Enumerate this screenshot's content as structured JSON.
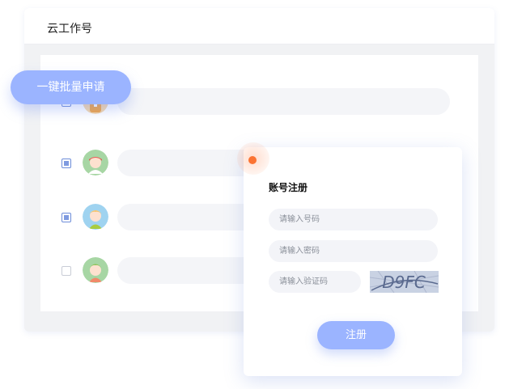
{
  "window": {
    "title": "云工作号"
  },
  "batch_button": {
    "label": "一键批量申请"
  },
  "rows": [
    {
      "checked": true,
      "avatar": "orange-hat-avatar-icon"
    },
    {
      "checked": true,
      "avatar": "red-hair-avatar-icon"
    },
    {
      "checked": true,
      "avatar": "blond-avatar-icon"
    },
    {
      "checked": false,
      "avatar": "green-hat-avatar-icon"
    }
  ],
  "register_card": {
    "title": "账号注册",
    "account_placeholder": "请输入号码",
    "password_placeholder": "请输入密码",
    "captcha_placeholder": "请输入验证码",
    "captcha_text": "D9FC",
    "submit_label": "注册"
  },
  "colors": {
    "accent": "#9bb4ff",
    "dot": "#fb7332",
    "field_bg": "#f3f4f8"
  }
}
